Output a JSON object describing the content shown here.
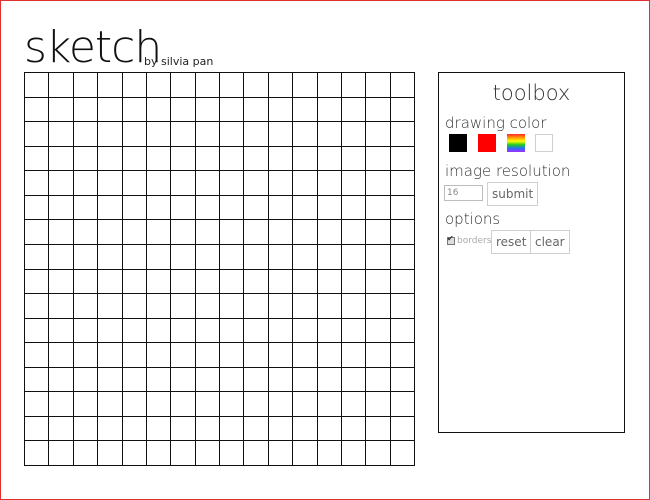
{
  "header": {
    "title": "sketch",
    "byline": "by silvia pan"
  },
  "canvas": {
    "rows": 16,
    "cols": 16
  },
  "toolbox": {
    "title": "toolbox",
    "drawing_color": {
      "label": "drawing color",
      "swatches": [
        {
          "name": "black",
          "color": "#000000"
        },
        {
          "name": "red",
          "color": "#ff0000"
        },
        {
          "name": "rainbow",
          "color": "rainbow"
        },
        {
          "name": "white",
          "color": "#ffffff"
        }
      ]
    },
    "image_resolution": {
      "label": "image resolution",
      "value": "16",
      "submit_label": "submit"
    },
    "options": {
      "label": "options",
      "borders_label": "borders",
      "borders_checked": true,
      "reset_label": "reset",
      "clear_label": "clear"
    }
  }
}
